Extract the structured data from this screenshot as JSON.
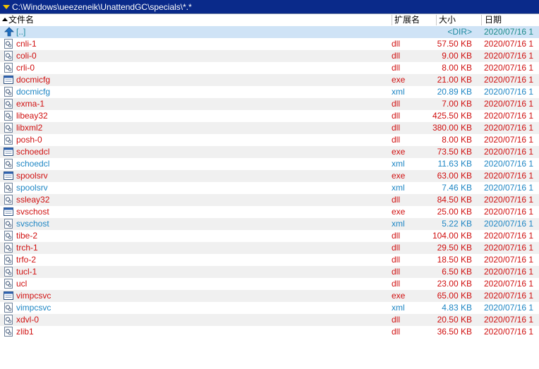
{
  "path_bar": {
    "path": "C:\\Windows\\ueezeneik\\UnattendGC\\specials\\*.*"
  },
  "columns": {
    "name": "文件名",
    "ext": "扩展名",
    "size": "大小",
    "date": "日期"
  },
  "colors": {
    "dll": "#d01010",
    "exe": "#d01010",
    "xml": "#1e86c4",
    "dir": "#1e8aa0",
    "path_bar_bg": "#0a2a8a"
  },
  "up_dir": {
    "name": "[..]",
    "size": "<DIR>",
    "date": "2020/07/16 1"
  },
  "files": [
    {
      "name": "cnli-1",
      "ext": "dll",
      "size": "57.50 KB",
      "date": "2020/07/16 1",
      "icon": "dll-icon"
    },
    {
      "name": "coli-0",
      "ext": "dll",
      "size": "9.00 KB",
      "date": "2020/07/16 1",
      "icon": "dll-icon"
    },
    {
      "name": "crli-0",
      "ext": "dll",
      "size": "8.00 KB",
      "date": "2020/07/16 1",
      "icon": "dll-icon"
    },
    {
      "name": "docmicfg",
      "ext": "exe",
      "size": "21.00 KB",
      "date": "2020/07/16 1",
      "icon": "exe-icon"
    },
    {
      "name": "docmicfg",
      "ext": "xml",
      "size": "20.89 KB",
      "date": "2020/07/16 1",
      "icon": "xml-icon"
    },
    {
      "name": "exma-1",
      "ext": "dll",
      "size": "7.00 KB",
      "date": "2020/07/16 1",
      "icon": "dll-icon"
    },
    {
      "name": "libeay32",
      "ext": "dll",
      "size": "425.50 KB",
      "date": "2020/07/16 1",
      "icon": "dll-icon"
    },
    {
      "name": "libxml2",
      "ext": "dll",
      "size": "380.00 KB",
      "date": "2020/07/16 1",
      "icon": "dll-icon"
    },
    {
      "name": "posh-0",
      "ext": "dll",
      "size": "8.00 KB",
      "date": "2020/07/16 1",
      "icon": "dll-icon"
    },
    {
      "name": "schoedcl",
      "ext": "exe",
      "size": "73.50 KB",
      "date": "2020/07/16 1",
      "icon": "exe-icon"
    },
    {
      "name": "schoedcl",
      "ext": "xml",
      "size": "11.63 KB",
      "date": "2020/07/16 1",
      "icon": "xml-icon"
    },
    {
      "name": "spoolsrv",
      "ext": "exe",
      "size": "63.00 KB",
      "date": "2020/07/16 1",
      "icon": "exe-icon"
    },
    {
      "name": "spoolsrv",
      "ext": "xml",
      "size": "7.46 KB",
      "date": "2020/07/16 1",
      "icon": "xml-icon"
    },
    {
      "name": "ssleay32",
      "ext": "dll",
      "size": "84.50 KB",
      "date": "2020/07/16 1",
      "icon": "dll-icon"
    },
    {
      "name": "svschost",
      "ext": "exe",
      "size": "25.00 KB",
      "date": "2020/07/16 1",
      "icon": "exe-icon"
    },
    {
      "name": "svschost",
      "ext": "xml",
      "size": "5.22 KB",
      "date": "2020/07/16 1",
      "icon": "xml-icon"
    },
    {
      "name": "tibe-2",
      "ext": "dll",
      "size": "104.00 KB",
      "date": "2020/07/16 1",
      "icon": "dll-icon"
    },
    {
      "name": "trch-1",
      "ext": "dll",
      "size": "29.50 KB",
      "date": "2020/07/16 1",
      "icon": "dll-icon"
    },
    {
      "name": "trfo-2",
      "ext": "dll",
      "size": "18.50 KB",
      "date": "2020/07/16 1",
      "icon": "dll-icon"
    },
    {
      "name": "tucl-1",
      "ext": "dll",
      "size": "6.50 KB",
      "date": "2020/07/16 1",
      "icon": "dll-icon"
    },
    {
      "name": "ucl",
      "ext": "dll",
      "size": "23.00 KB",
      "date": "2020/07/16 1",
      "icon": "dll-icon"
    },
    {
      "name": "vimpcsvc",
      "ext": "exe",
      "size": "65.00 KB",
      "date": "2020/07/16 1",
      "icon": "exe-icon"
    },
    {
      "name": "vimpcsvc",
      "ext": "xml",
      "size": "4.83 KB",
      "date": "2020/07/16 1",
      "icon": "xml-icon"
    },
    {
      "name": "xdvl-0",
      "ext": "dll",
      "size": "20.50 KB",
      "date": "2020/07/16 1",
      "icon": "dll-icon"
    },
    {
      "name": "zlib1",
      "ext": "dll",
      "size": "36.50 KB",
      "date": "2020/07/16 1",
      "icon": "dll-icon"
    }
  ]
}
